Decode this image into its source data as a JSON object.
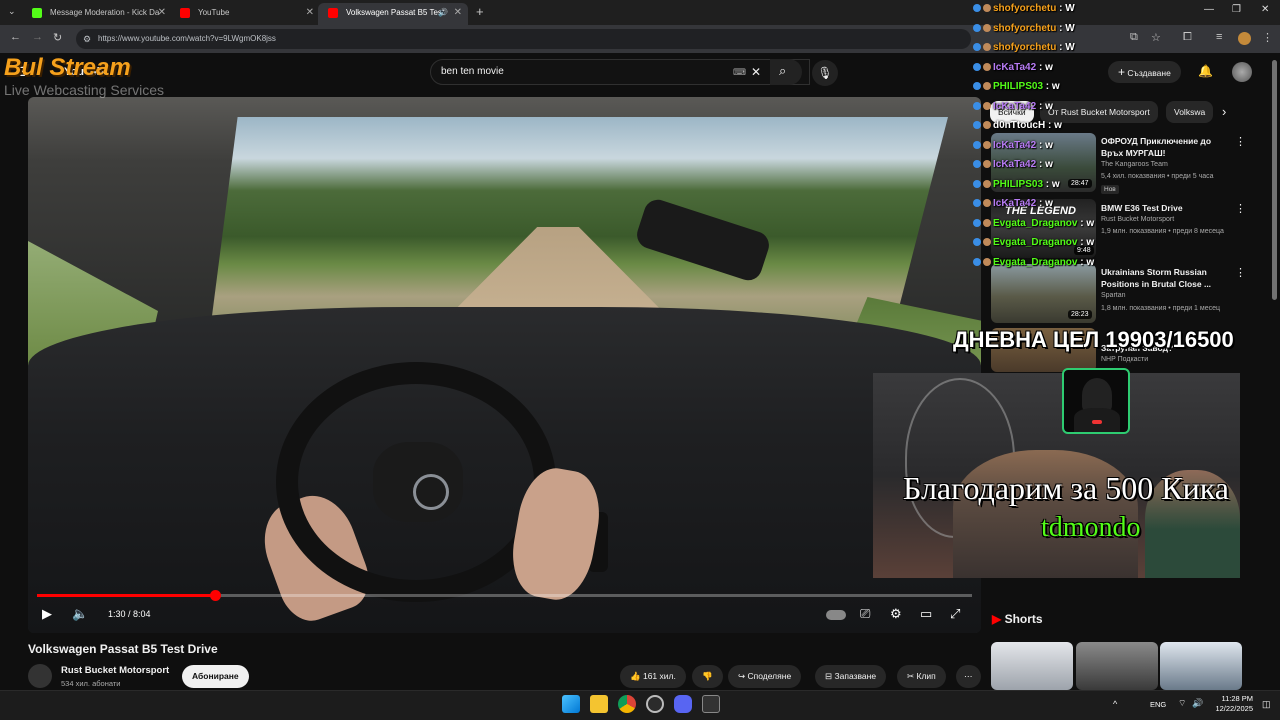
{
  "browser": {
    "tabs": [
      {
        "title": "Message Moderation - Kick Da",
        "favicon_color": "#53fc18"
      },
      {
        "title": "YouTube",
        "favicon_color": "#ff0000"
      },
      {
        "title": "Volkswagen Passat B5 Test",
        "favicon_color": "#ff0000"
      }
    ],
    "url": "https://www.youtube.com/watch?v=9LWgmOK8jss",
    "new_tab": "+"
  },
  "youtube": {
    "search_value": "ben ten movie",
    "logo": "YouTube",
    "create_label": "Създаване",
    "video": {
      "title": "Volkswagen Passat B5 Test Drive",
      "time": "1:30 / 8:04",
      "progress": 0.19
    },
    "channel": {
      "name": "Rust Bucket Motorsport",
      "subs": "534 хил. абонати",
      "subscribe_label": "Абониране"
    },
    "actions": {
      "likes": "161 хил.",
      "share": "Споделяне",
      "save": "Запазване",
      "clip": "Клип"
    },
    "chips": [
      "Всички",
      "От Rust Bucket Motorsport",
      "Volkswa"
    ],
    "recommendations": [
      {
        "title": "ОФРОУД Приключение до Връх МУРГАШ!",
        "channel": "The Kangaroos Team",
        "meta": "5,4 хил. показвания • преди 5 часа",
        "badge": "Нов",
        "duration": "28:47"
      },
      {
        "title": "BMW E36 Test Drive",
        "channel": "Rust Bucket Motorsport",
        "meta": "1,9 млн. показвания • преди 8 месеца",
        "badge": "",
        "duration": "9:48"
      },
      {
        "title": "Ukrainians Storm Russian Positions in Brutal Close ...",
        "channel": "Spartan",
        "meta": "1,8 млн. показвания • преди 1 месец",
        "badge": "",
        "duration": "28:23"
      },
      {
        "title": "Затрупан Завод?",
        "channel": "NHP Подкасти",
        "meta": "",
        "badge": "",
        "duration": ""
      }
    ],
    "thumb_overlay_text": "THE LEGEND",
    "shorts_label": "Shorts"
  },
  "stream_overlay": {
    "brand": "Bul Stream",
    "brand_sub": "Live Webcasting Services",
    "daily_goal": "ДНЕВНА ЦЕЛ 19903/16500",
    "thanks": "Благодарим за 500 Кика",
    "thanks_name": "tdmondo",
    "chat": [
      {
        "user": "shofyorchetu",
        "msg": "W",
        "color": "#f6a11c"
      },
      {
        "user": "shofyorchetu",
        "msg": "W",
        "color": "#f6a11c"
      },
      {
        "user": "shofyorchetu",
        "msg": "W",
        "color": "#f6a11c"
      },
      {
        "user": "IcKaTa42",
        "msg": "w",
        "color": "#b87cf5"
      },
      {
        "user": "PHILIPS03",
        "msg": "w",
        "color": "#53fc18"
      },
      {
        "user": "IcKaTa42",
        "msg": "w",
        "color": "#b87cf5"
      },
      {
        "user": "d0nTtoucH",
        "msg": "w",
        "color": "#ffffff"
      },
      {
        "user": "IcKaTa42",
        "msg": "w",
        "color": "#b87cf5"
      },
      {
        "user": "IcKaTa42",
        "msg": "w",
        "color": "#b87cf5"
      },
      {
        "user": "PHILIPS03",
        "msg": "w",
        "color": "#53fc18"
      },
      {
        "user": "IcKaTa42",
        "msg": "w",
        "color": "#b87cf5"
      },
      {
        "user": "Evgata_Draganov",
        "msg": "w",
        "color": "#53fc18"
      },
      {
        "user": "Evgata_Draganov",
        "msg": "w",
        "color": "#53fc18"
      },
      {
        "user": "Evgata_Draganov",
        "msg": "w",
        "color": "#53fc18"
      }
    ]
  },
  "taskbar": {
    "lang": "ENG",
    "time": "11:28 PM",
    "date": "12/22/2025"
  }
}
